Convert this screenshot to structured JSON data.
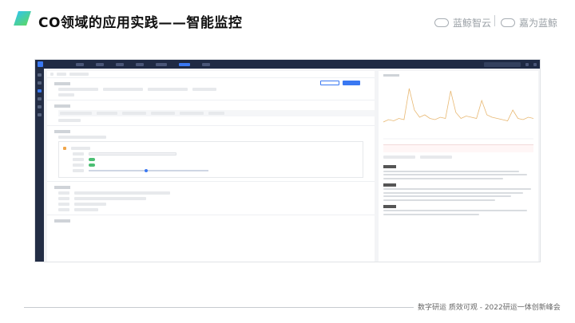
{
  "slide": {
    "title": "CO领域的应用实践——智能监控",
    "footer": "数字研运 质效可观 - 2022研运一体创新峰会"
  },
  "brands": [
    {
      "name": "蓝鲸智云"
    },
    {
      "name": "嘉为蓝鲸"
    }
  ],
  "colors": {
    "accent_start": "#33c6e6",
    "accent_end": "#5ad66a",
    "topbar": "#1f2a44",
    "primary": "#3a78f2",
    "chart_line": "#e8b872"
  },
  "screenshot": {
    "main_sections": 5,
    "chart_series": [
      12,
      14,
      13,
      15,
      14,
      40,
      22,
      16,
      18,
      15,
      14,
      16,
      15,
      38,
      20,
      15,
      17,
      16,
      15,
      30,
      18,
      16,
      15,
      14,
      13,
      22,
      15,
      14,
      16,
      15
    ]
  }
}
